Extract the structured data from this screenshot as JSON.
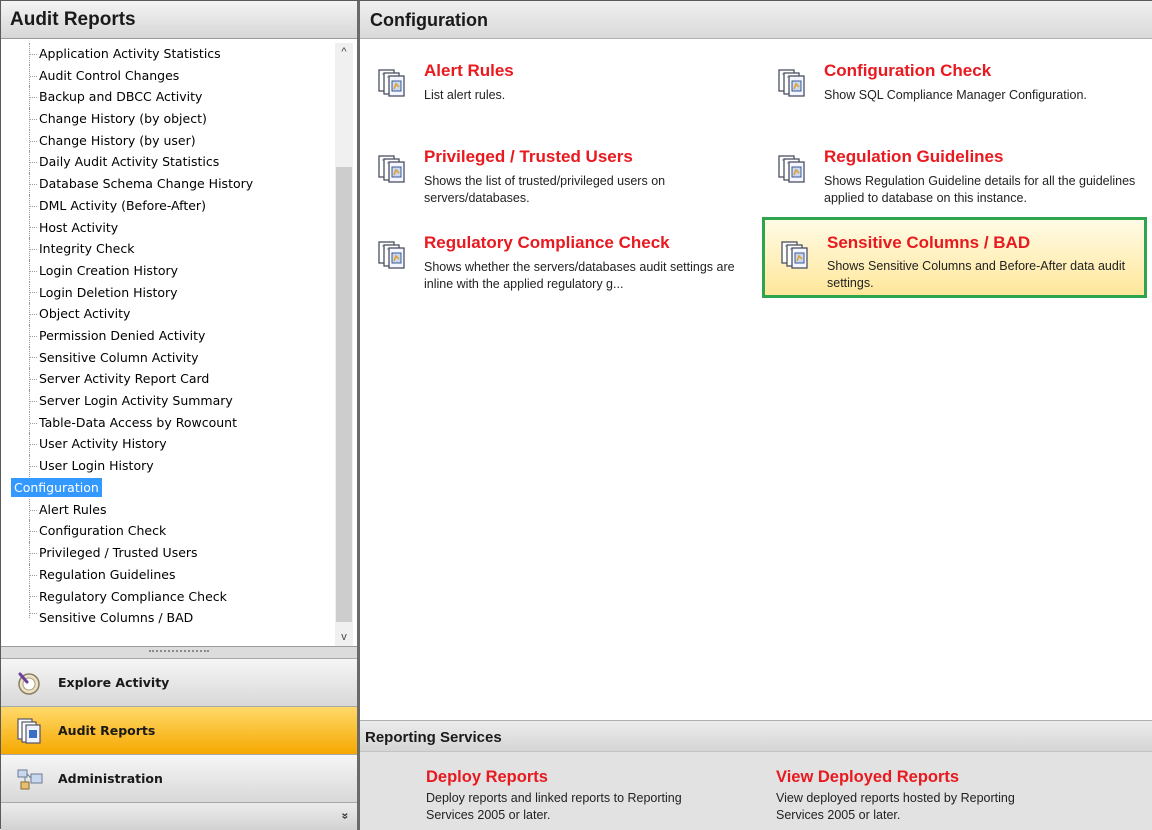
{
  "left_panel": {
    "title": "Audit Reports",
    "tree_items_top": [
      "Application Activity Statistics",
      "Audit Control Changes",
      "Backup and DBCC Activity",
      "Change History (by object)",
      "Change History (by user)",
      "Daily Audit Activity Statistics",
      "Database Schema Change History",
      "DML Activity (Before-After)",
      "Host Activity",
      "Integrity Check",
      "Login Creation History",
      "Login Deletion History",
      "Object Activity",
      "Permission Denied Activity",
      "Sensitive Column Activity",
      "Server Activity Report Card",
      "Server Login Activity Summary",
      "Table-Data Access by Rowcount",
      "User Activity History",
      "User Login History"
    ],
    "group_label": "Configuration",
    "tree_items_config": [
      "Alert Rules",
      "Configuration Check",
      "Privileged / Trusted Users",
      "Regulation Guidelines",
      "Regulatory Compliance Check",
      "Sensitive Columns / BAD"
    ],
    "scroll_up": "^",
    "scroll_down": "v",
    "nav": {
      "explore": "Explore Activity",
      "audit": "Audit Reports",
      "admin": "Administration",
      "more": "»"
    }
  },
  "right_panel": {
    "title": "Configuration",
    "cards": [
      {
        "title": "Alert Rules",
        "desc": "List alert rules."
      },
      {
        "title": "Configuration Check",
        "desc": "Show SQL Compliance Manager Configuration."
      },
      {
        "title": "Privileged / Trusted Users",
        "desc": "Shows the list of trusted/privileged users on servers/databases."
      },
      {
        "title": "Regulation Guidelines",
        "desc": "Shows Regulation Guideline details for all the guidelines applied to database on this instance."
      },
      {
        "title": "Regulatory Compliance Check",
        "desc": "Shows whether the servers/databases audit settings are inline with the applied regulatory g..."
      },
      {
        "title": "Sensitive Columns / BAD",
        "desc": "Shows Sensitive Columns and Before-After data audit settings."
      }
    ],
    "reporting_services": {
      "title": "Reporting Services",
      "items": [
        {
          "title": "Deploy Reports",
          "desc": "Deploy reports and linked reports to Reporting Services 2005 or later."
        },
        {
          "title": "View Deployed Reports",
          "desc": "View deployed reports hosted by Reporting Services 2005 or later."
        }
      ]
    }
  },
  "icons": {
    "card": "report-stack-icon",
    "explore": "explore-activity-icon",
    "audit": "audit-reports-icon",
    "admin": "administration-icon"
  },
  "colors": {
    "link_red": "#e8191f",
    "active_nav": "#f6a800",
    "selection_border": "#2ea44f",
    "tree_highlight": "#3399ff"
  }
}
